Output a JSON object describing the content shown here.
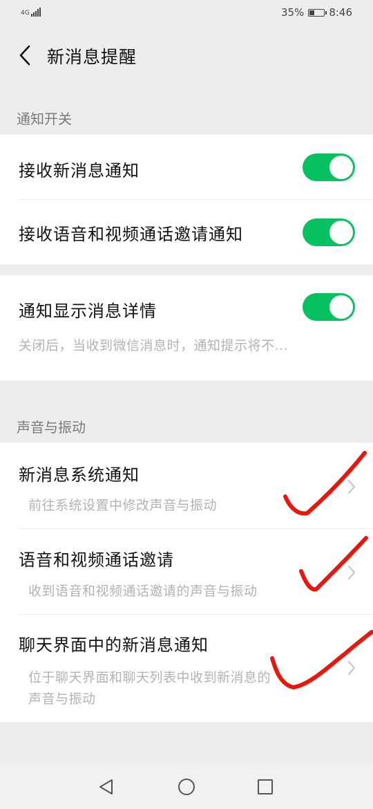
{
  "status_bar": {
    "network": "4G",
    "battery_percent": "35%",
    "battery_level": 0.35,
    "time": "8:46"
  },
  "nav": {
    "title": "新消息提醒",
    "back_icon": "chevron-left-icon"
  },
  "sections": {
    "notification_switch": {
      "header": "通知开关",
      "receive_new": {
        "label": "接收新消息通知",
        "on": true
      },
      "receive_call": {
        "label": "接收语音和视频通话邀请通知",
        "on": true
      },
      "show_details": {
        "label": "通知显示消息详情",
        "desc": "关闭后，当收到微信消息时，通知提示将不...",
        "on": true
      }
    },
    "sound_vibration": {
      "header": "声音与振动",
      "system_notify": {
        "label": "新消息系统通知",
        "desc": "前往系统设置中修改声音与振动"
      },
      "call_invite": {
        "label": "语音和视频通话邀请",
        "desc": "收到语音和视频通话邀请的声音与振动"
      },
      "chat_notify": {
        "label": "聊天界面中的新消息通知",
        "desc_line1": "位于聊天界面和聊天列表中收到新消息的",
        "desc_line2": "声音与振动"
      }
    }
  },
  "annotation_color": "#e8160c",
  "accent_color": "#07c160",
  "system_nav": {
    "back": "triangle-back-icon",
    "home": "circle-home-icon",
    "recents": "square-recents-icon"
  }
}
